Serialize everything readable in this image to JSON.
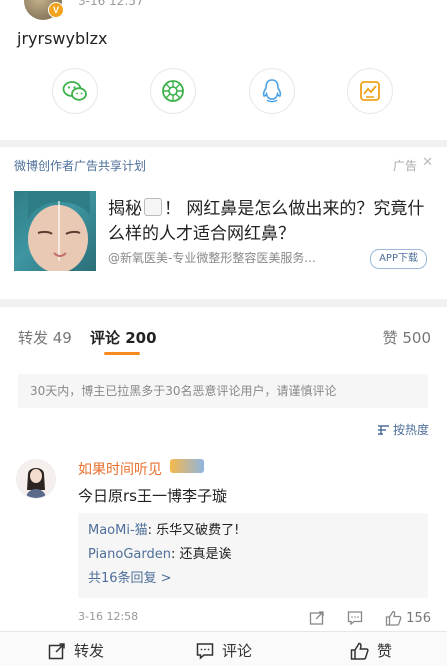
{
  "post": {
    "time": "3-16 12:57",
    "text": "jryrswyblzx",
    "verified_mark": "V",
    "share_icons": [
      "wechat-icon",
      "moments-icon",
      "qq-icon",
      "qzone-icon"
    ]
  },
  "ad": {
    "label": "微博创作者广告共享计划",
    "tag": "广告",
    "close": "✕",
    "title_before": "揭秘",
    "title_after": "！ 网红鼻是怎么做出来的？究竟什么样的人才适合网红鼻？",
    "source": "@新氧医美-专业微整形整容医美服务...",
    "button": "APP下载"
  },
  "tabs": {
    "repost": "转发 49",
    "comment": "评论 200",
    "like": "赞 500"
  },
  "notice": "30天内，博主已拉黑多于30名恶意评论用户，请谨慎评论",
  "sort": "按热度",
  "comment": {
    "author": "如果时间听见",
    "text": "今日原rs王一博李子璇",
    "time": "3-16 12:58",
    "like_count": "156",
    "replies": [
      {
        "name": "MaoMi-猫",
        "text": ": 乐华又破费了!"
      },
      {
        "name": "PianoGarden",
        "text": ": 还真是诶"
      }
    ],
    "more": "共16条回复 >"
  },
  "bottom": {
    "repost": "转发",
    "comment": "评论",
    "like": "赞"
  }
}
